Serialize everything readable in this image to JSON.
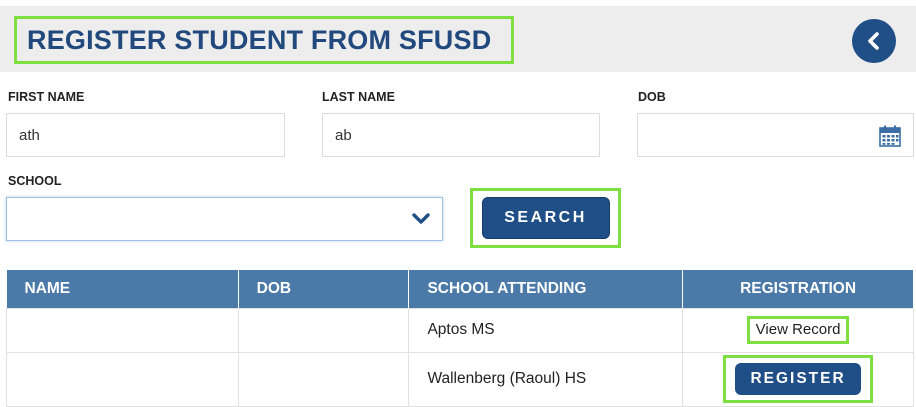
{
  "header": {
    "title": "REGISTER STUDENT FROM SFUSD",
    "back_icon": "chevron-left-icon"
  },
  "form": {
    "first_name": {
      "label": "FIRST NAME",
      "value": "ath"
    },
    "last_name": {
      "label": "LAST NAME",
      "value": "ab"
    },
    "dob": {
      "label": "DOB",
      "value": "",
      "icon": "calendar-icon"
    },
    "school": {
      "label": "SCHOOL",
      "value": "",
      "icon": "chevron-down-icon"
    },
    "search_label": "SEARCH"
  },
  "table": {
    "columns": [
      "NAME",
      "DOB",
      "SCHOOL ATTENDING",
      "REGISTRATION"
    ],
    "rows": [
      {
        "name": "",
        "dob": "",
        "school": "Aptos MS",
        "action": "View Record"
      },
      {
        "name": "",
        "dob": "",
        "school": "Wallenberg (Raoul) HS",
        "action": "REGISTER"
      }
    ]
  },
  "colors": {
    "brand": "#1f4f86",
    "table_header": "#4b79a8",
    "highlight": "#7ee040",
    "title_text": "#21497d"
  }
}
